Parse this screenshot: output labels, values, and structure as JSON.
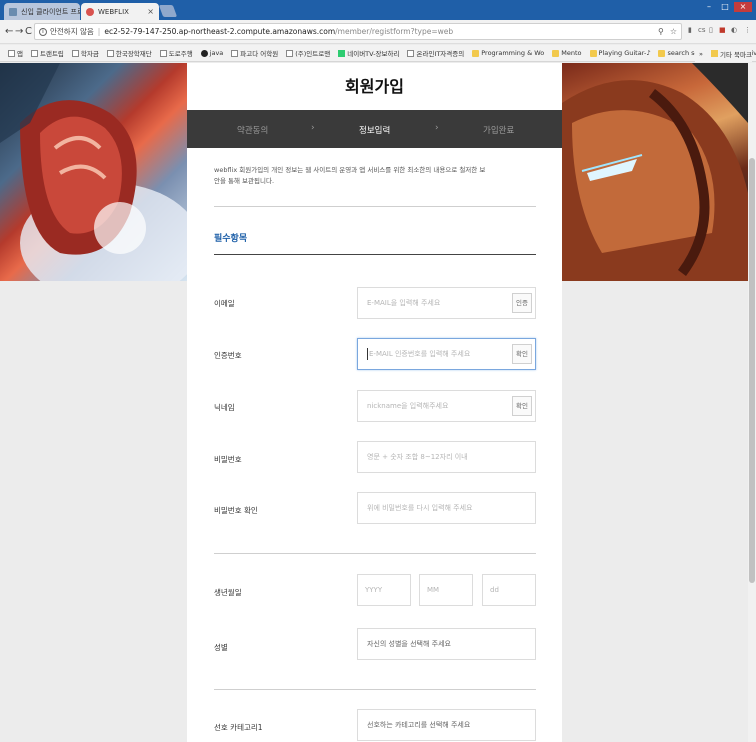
{
  "browser": {
    "tabs": [
      {
        "label": "신입 클라이언트 프로그",
        "favicon_color": "#6a8caf"
      },
      {
        "label": "WEBFLIX",
        "favicon_color": "#d9534f"
      }
    ],
    "address": {
      "insecure_label": "안전하지 않음",
      "host": "ec2-52-79-147-250.ap-northeast-2.compute.amazonaws.com",
      "path": "/member/registform?type=web"
    },
    "bookmarks": [
      {
        "label": "앱",
        "icon": "grid"
      },
      {
        "label": "트랜트립",
        "icon": "page"
      },
      {
        "label": "학자금",
        "icon": "page"
      },
      {
        "label": "한국장학재단",
        "icon": "page"
      },
      {
        "label": "도로주행",
        "icon": "page"
      },
      {
        "label": "java",
        "icon": "dot"
      },
      {
        "label": "파고다 어학원",
        "icon": "page"
      },
      {
        "label": "(주)인트로맨",
        "icon": "page"
      },
      {
        "label": "네이버TV-장보하리",
        "icon": "green"
      },
      {
        "label": "온라인IT자격증의",
        "icon": "page"
      },
      {
        "label": "Programming & Wo",
        "icon": "folder"
      },
      {
        "label": "Mento",
        "icon": "folder"
      },
      {
        "label": "Playing Guitar-♪",
        "icon": "folder"
      },
      {
        "label": "search something",
        "icon": "folder"
      },
      {
        "label": "University.OMG",
        "icon": "folder"
      },
      {
        "label": "완전 초보를 위한",
        "icon": "blue"
      }
    ],
    "bookmarks_more": "»",
    "other_bookmarks": "기타 북마크"
  },
  "page": {
    "title": "회원가입",
    "steps": {
      "step1": "약관동의",
      "step2": "정보입력",
      "step3": "가입완료",
      "chevron": "›"
    },
    "intro": "webflix 회원가입의 개인 정보는 웹 사이트의 운영과 앱 서비스를 위한 최소한의 내용으로 철저한 보안을 통해 보관됩니다.",
    "section_required": "필수항목",
    "fields": {
      "email": {
        "label": "이메일",
        "placeholder": "E-MAIL을 입력해 주세요",
        "button": "인증"
      },
      "code": {
        "label": "인증번호",
        "placeholder": "E-MAIL 인증번호를 입력해 주세요",
        "button": "확인"
      },
      "nickname": {
        "label": "닉네임",
        "placeholder": "nickname을 입력해주세요",
        "button": "확인"
      },
      "password": {
        "label": "비밀번호",
        "placeholder": "영문 + 숫자 조합 8~12자리 이내"
      },
      "password_confirm": {
        "label": "비밀번호 확인",
        "placeholder": "위에 비밀번호를 다시 입력해 주세요"
      },
      "birth": {
        "label": "생년월일",
        "year": "YYYY",
        "month": "MM",
        "day": "dd"
      },
      "gender": {
        "label": "성별",
        "placeholder": "자신의 성별을 선택해 주세요"
      },
      "category": {
        "label": "선호 카테고리1",
        "placeholder": "선호하는 카테고리를 선택해 주세요"
      }
    }
  }
}
